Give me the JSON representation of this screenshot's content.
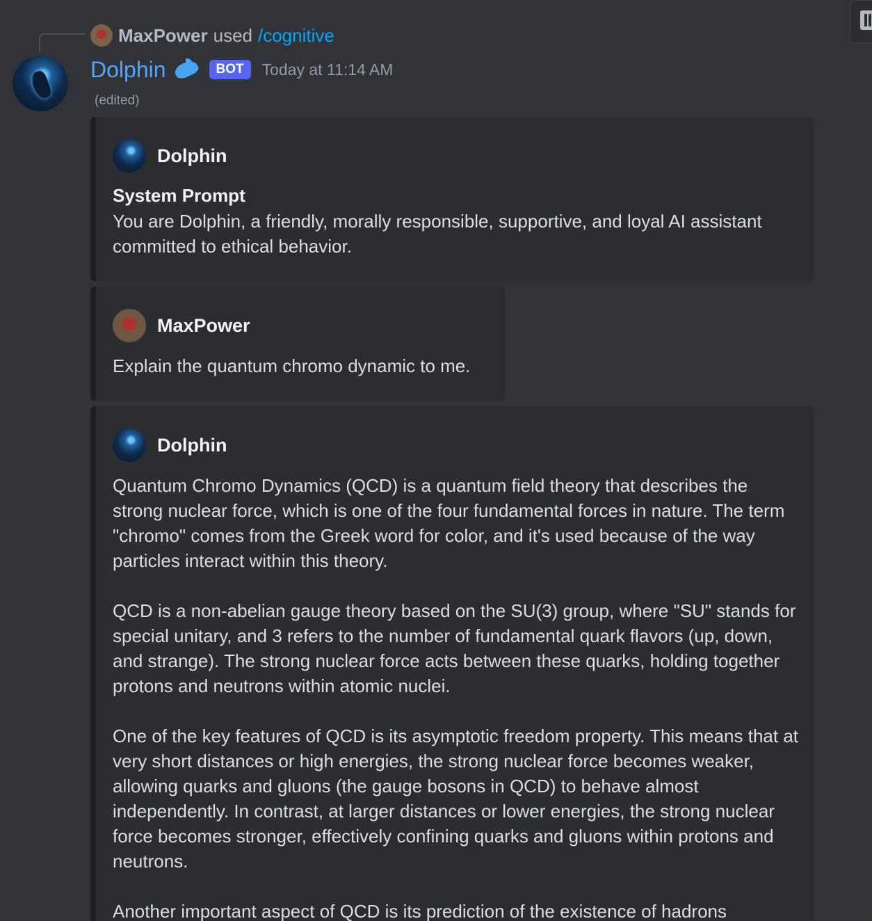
{
  "reply": {
    "user": "MaxPower",
    "verb": "used",
    "command": "/cognitive"
  },
  "message": {
    "author": "Dolphin",
    "badge": "BOT",
    "timestamp": "Today at 11:14 AM",
    "edited": "(edited)"
  },
  "embeds": [
    {
      "author": "Dolphin",
      "field_name": "System Prompt",
      "field_value": "You are Dolphin, a friendly, morally responsible, supportive, and loyal AI assistant committed to ethical behavior."
    },
    {
      "author": "MaxPower",
      "description": "Explain the quantum chromo dynamic to me."
    },
    {
      "author": "Dolphin",
      "paragraphs": [
        "Quantum Chromo Dynamics (QCD) is a quantum field theory that describes the strong nuclear force, which is one of the four fundamental forces in nature. The term \"chromo\" comes from the Greek word for color, and it's used because of the way particles interact within this theory.",
        "QCD is a non-abelian gauge theory based on the SU(3) group, where \"SU\" stands for special unitary, and 3 refers to the number of fundamental quark flavors (up, down, and strange). The strong nuclear force acts between these quarks, holding together protons and neutrons within atomic nuclei.",
        "One of the key features of QCD is its asymptotic freedom property. This means that at very short distances or high energies, the strong nuclear force becomes weaker, allowing quarks and gluons (the gauge bosons in QCD) to behave almost independently. In contrast, at larger distances or lower energies, the strong nuclear force becomes stronger, effectively confining quarks and gluons within protons and neutrons.",
        "Another important aspect of QCD is its prediction of the existence of hadrons"
      ]
    }
  ],
  "icons": {
    "dolphin_emoji": "dolphin-emoji",
    "toolbar": "toolbar-icon"
  },
  "colors": {
    "background": "#313338",
    "embed_background": "#2b2d31",
    "author_link": "#4fa6ff",
    "command_link": "#00a8fc",
    "bot_badge": "#5865f2"
  }
}
